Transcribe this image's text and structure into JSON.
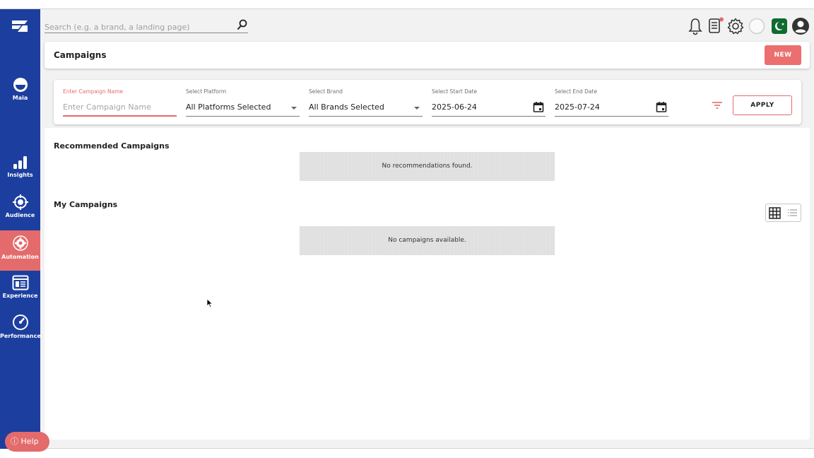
{
  "header": {
    "search_placeholder": "Search (e.g. a brand, a landing page)",
    "icons": [
      "bell-icon",
      "document-icon",
      "gear-icon",
      "circle-icon",
      "flag-icon",
      "account-icon"
    ]
  },
  "sidebar": {
    "items": [
      {
        "label": "Maia",
        "icon": "maia-icon"
      },
      {
        "label": "Insights",
        "icon": "bar-chart-icon"
      },
      {
        "label": "Audience",
        "icon": "target-icon"
      },
      {
        "label": "Automation",
        "icon": "gear-icon",
        "active": true
      },
      {
        "label": "Experience",
        "icon": "layout-icon"
      },
      {
        "label": "Performance",
        "icon": "gauge-icon"
      }
    ],
    "help_label": "Help"
  },
  "page": {
    "title": "Campaigns",
    "new_label": "NEW"
  },
  "filters": {
    "campaign_name": {
      "label": "Enter Campaign Name",
      "placeholder": "Enter Campaign Name"
    },
    "platform": {
      "label": "Select Platform",
      "value": "All Platforms Selected"
    },
    "brand": {
      "label": "Select Brand",
      "value": "All Brands Selected"
    },
    "start_date": {
      "label": "Select Start Date",
      "value": "2025-06-24"
    },
    "end_date": {
      "label": "Select End Date",
      "value": "2025-07-24"
    },
    "apply_label": "APPLY"
  },
  "recommended": {
    "title": "Recommended Campaigns",
    "empty_text": "No recommendations found."
  },
  "my_campaigns": {
    "title": "My Campaigns",
    "empty_text": "No campaigns available."
  },
  "colors": {
    "sidebar": "#1c3f9f",
    "accent": "#e46b6b",
    "flag_green": "#0f6b2f"
  }
}
